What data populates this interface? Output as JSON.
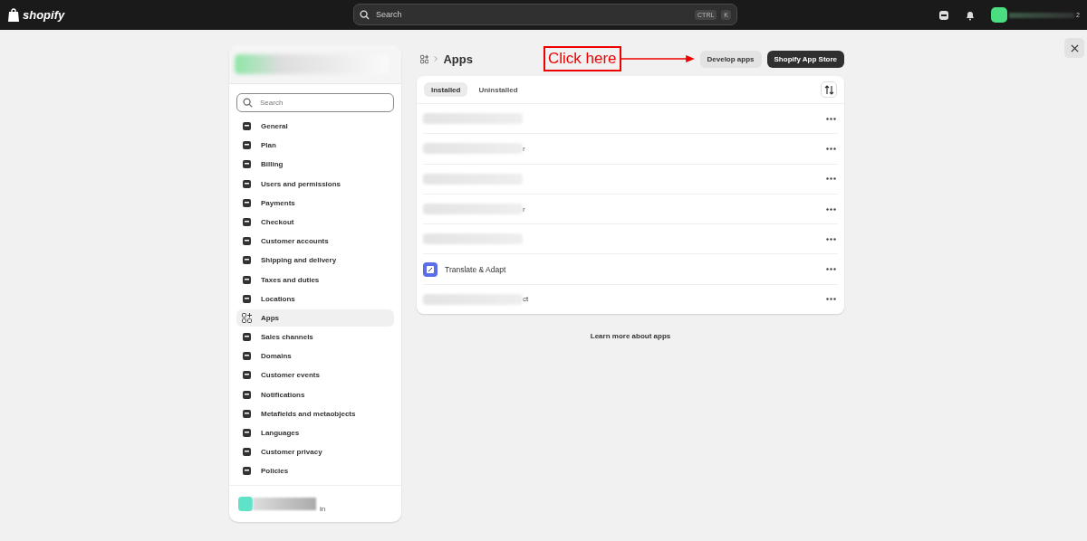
{
  "topbar": {
    "logo": "shopify",
    "search": {
      "placeholder": "Search",
      "keys": [
        "CTRL",
        "K"
      ]
    },
    "account_tail": "2"
  },
  "sidebar": {
    "search": {
      "placeholder": "Search"
    },
    "items": [
      {
        "label": "General",
        "selected": false
      },
      {
        "label": "Plan",
        "selected": false
      },
      {
        "label": "Billing",
        "selected": false
      },
      {
        "label": "Users and permissions",
        "selected": false
      },
      {
        "label": "Payments",
        "selected": false
      },
      {
        "label": "Checkout",
        "selected": false
      },
      {
        "label": "Customer accounts",
        "selected": false
      },
      {
        "label": "Shipping and delivery",
        "selected": false
      },
      {
        "label": "Taxes and duties",
        "selected": false
      },
      {
        "label": "Locations",
        "selected": false
      },
      {
        "label": "Apps",
        "selected": true
      },
      {
        "label": "Sales channels",
        "selected": false
      },
      {
        "label": "Domains",
        "selected": false
      },
      {
        "label": "Customer events",
        "selected": false
      },
      {
        "label": "Notifications",
        "selected": false
      },
      {
        "label": "Metafields and metaobjects",
        "selected": false
      },
      {
        "label": "Languages",
        "selected": false
      },
      {
        "label": "Customer privacy",
        "selected": false
      },
      {
        "label": "Policies",
        "selected": false
      }
    ],
    "user_tail": "in"
  },
  "page": {
    "title": "Apps",
    "annotation": "Click here",
    "buttons": [
      {
        "label": "Develop apps",
        "kind": "secondary"
      },
      {
        "label": "Shopify App Store",
        "kind": "primary"
      }
    ]
  },
  "tabs": [
    {
      "label": "Installed",
      "selected": true
    },
    {
      "label": "Uninstalled",
      "selected": false
    }
  ],
  "apps": [
    {
      "kind": "redacted"
    },
    {
      "kind": "redacted",
      "tail": "r"
    },
    {
      "kind": "redacted"
    },
    {
      "kind": "redacted",
      "tail": "r"
    },
    {
      "kind": "redacted"
    },
    {
      "kind": "app",
      "name": "Translate & Adapt"
    },
    {
      "kind": "redacted",
      "tail": "ct"
    }
  ],
  "footer_link": "Learn more about apps"
}
